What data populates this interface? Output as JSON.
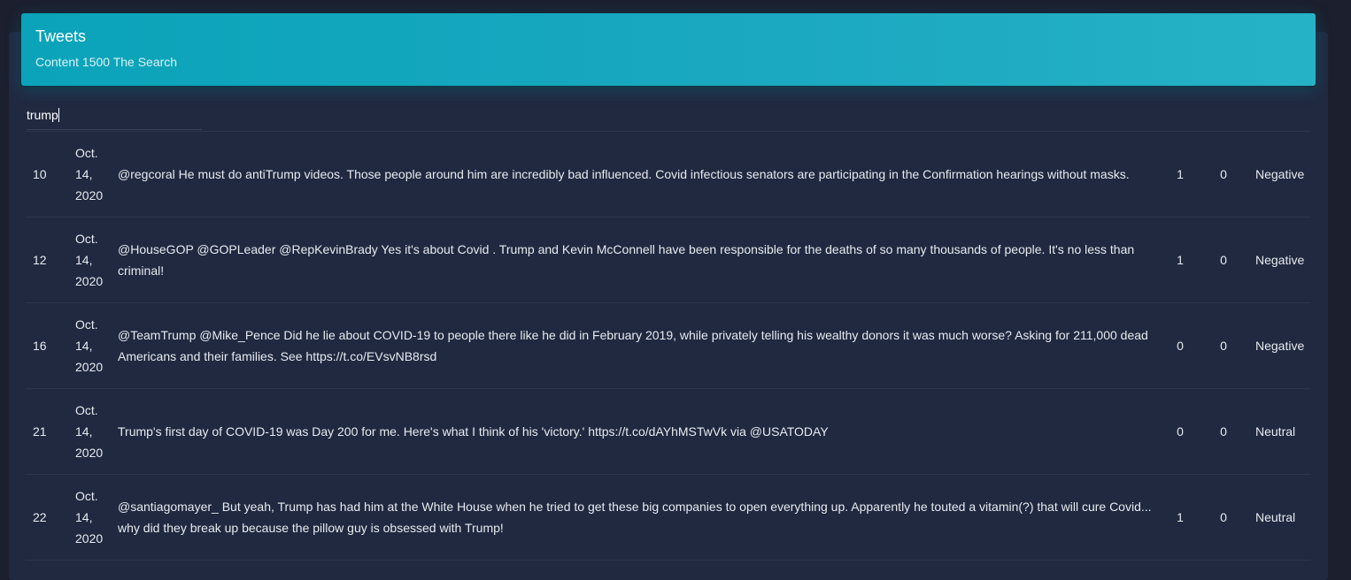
{
  "header": {
    "title": "Tweets",
    "subtitle": "Content 1500 The Search"
  },
  "search": {
    "value": "trump",
    "placeholder": ""
  },
  "rows": [
    {
      "id": "10",
      "date": {
        "month": "Oct.",
        "day": "14,",
        "year": "2020"
      },
      "text": "@regcoral He must do antiTrump videos. Those people around him are incredibly bad influenced. Covid infectious senators are participating in the Confirmation hearings without masks.",
      "likes": "1",
      "retweets": "0",
      "sentiment": "Negative"
    },
    {
      "id": "12",
      "date": {
        "month": "Oct.",
        "day": "14,",
        "year": "2020"
      },
      "text": "@HouseGOP @GOPLeader @RepKevinBrady Yes it's about Covid . Trump and Kevin McConnell have been responsible for the deaths of so many thousands of people. It's no less than criminal!",
      "likes": "1",
      "retweets": "0",
      "sentiment": "Negative"
    },
    {
      "id": "16",
      "date": {
        "month": "Oct.",
        "day": "14,",
        "year": "2020"
      },
      "text": "@TeamTrump @Mike_Pence Did he lie about COVID-19 to people there like he did in February 2019, while privately telling his wealthy donors it was much worse? Asking for 211,000 dead Americans and their families. See https://t.co/EVsvNB8rsd",
      "likes": "0",
      "retweets": "0",
      "sentiment": "Negative"
    },
    {
      "id": "21",
      "date": {
        "month": "Oct.",
        "day": "14,",
        "year": "2020"
      },
      "text": "Trump's first day of COVID-19 was Day 200 for me. Here's what I think of his 'victory.' https://t.co/dAYhMSTwVk via @USATODAY",
      "likes": "0",
      "retweets": "0",
      "sentiment": "Neutral"
    },
    {
      "id": "22",
      "date": {
        "month": "Oct.",
        "day": "14,",
        "year": "2020"
      },
      "text": "@santiagomayer_ But yeah, Trump has had him at the White House when he tried to get these big companies to open everything up. Apparently he touted a vitamin(?) that will cure Covid... why did they break up because the pillow guy is obsessed with Trump!",
      "likes": "1",
      "retweets": "0",
      "sentiment": "Neutral"
    }
  ]
}
